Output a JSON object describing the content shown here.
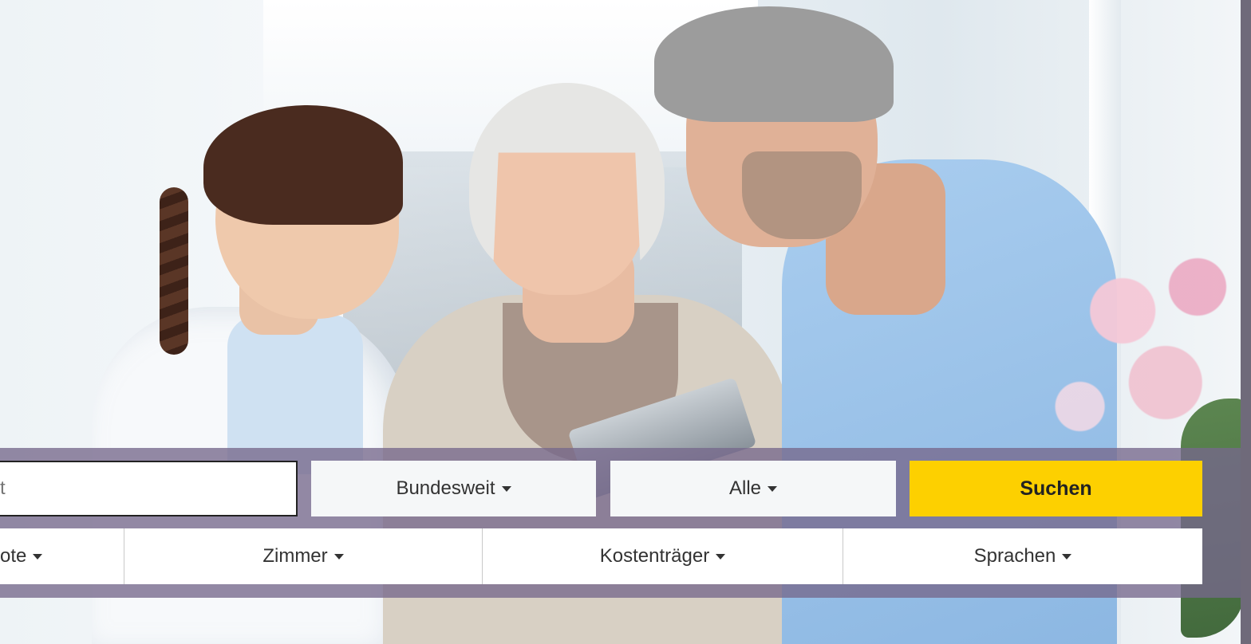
{
  "search": {
    "placeholder": "t",
    "region_label": "Bundesweit",
    "type_label": "Alle",
    "submit_label": "Suchen"
  },
  "filters": {
    "items": [
      {
        "label": "ote"
      },
      {
        "label": "Zimmer"
      },
      {
        "label": "Kostenträger"
      },
      {
        "label": "Sprachen"
      }
    ]
  },
  "colors": {
    "panel": "#76688c",
    "accent": "#fdd000",
    "dropdown_bg": "#f5f7f8"
  },
  "icons": {
    "caret": "caret-down-icon"
  }
}
